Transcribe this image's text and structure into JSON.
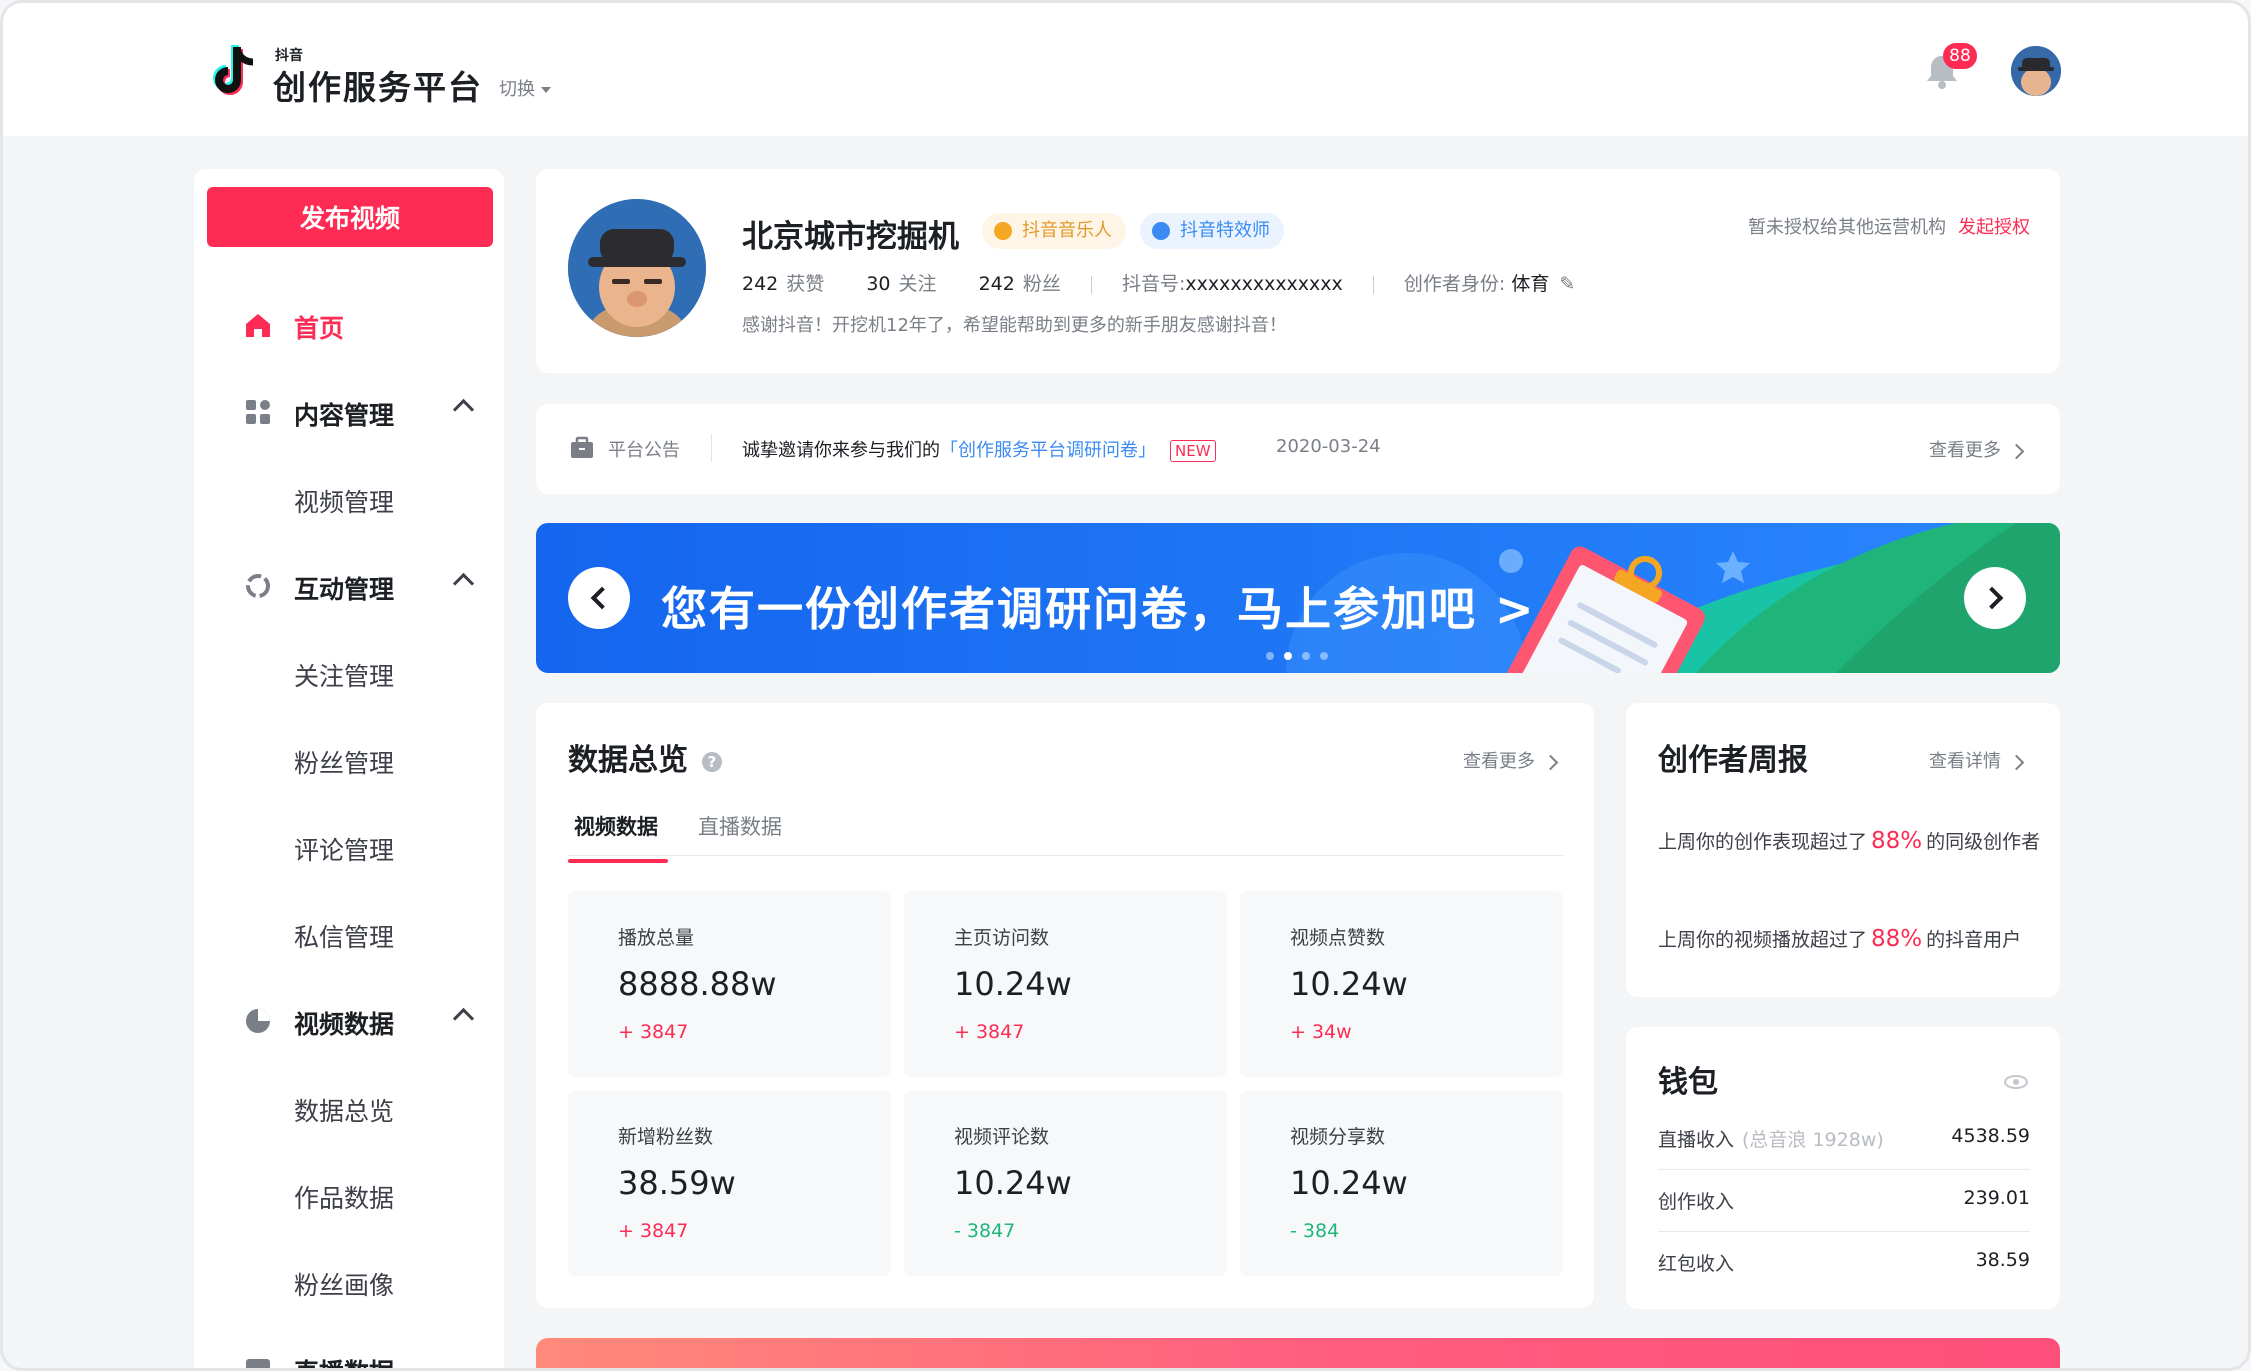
{
  "header": {
    "brand_small": "抖音",
    "brand_title": "创作服务平台",
    "switch_label": "切换",
    "notification_count": "88"
  },
  "sidebar": {
    "publish_label": "发布视频",
    "items": [
      {
        "label": "首页"
      },
      {
        "label": "内容管理"
      },
      {
        "label": "视频管理"
      },
      {
        "label": "互动管理"
      },
      {
        "label": "关注管理"
      },
      {
        "label": "粉丝管理"
      },
      {
        "label": "评论管理"
      },
      {
        "label": "私信管理"
      },
      {
        "label": "视频数据"
      },
      {
        "label": "数据总览"
      },
      {
        "label": "作品数据"
      },
      {
        "label": "粉丝画像"
      },
      {
        "label": "直播数据"
      }
    ]
  },
  "profile": {
    "name": "北京城市挖掘机",
    "tag_musician": "抖音音乐人",
    "tag_effects": "抖音特效师",
    "likes_count": "242",
    "likes_label": "获赞",
    "following_count": "30",
    "following_label": "关注",
    "fans_count": "242",
    "fans_label": "粉丝",
    "douyin_id_label": "抖音号:",
    "douyin_id": "xxxxxxxxxxxxxx",
    "identity_label": "创作者身份:",
    "identity_value": "体育",
    "bio": "感谢抖音！开挖机12年了，希望能帮助到更多的新手朋友感谢抖音！",
    "auth_note": "暂未授权给其他运营机构",
    "auth_link": "发起授权"
  },
  "notice": {
    "label": "平台公告",
    "text_prefix": "诚挚邀请你来参与我们的",
    "link": "「创作服务平台调研问卷」",
    "new_tag": "NEW",
    "date": "2020-03-24",
    "more": "查看更多"
  },
  "banner": {
    "text": "您有一份创作者调研问卷，马上参加吧 >"
  },
  "overview": {
    "title": "数据总览",
    "more": "查看更多",
    "tabs": [
      {
        "label": "视频数据"
      },
      {
        "label": "直播数据"
      }
    ],
    "metrics": [
      {
        "label": "播放总量",
        "value": "8888.88w",
        "delta": "+ 3847"
      },
      {
        "label": "主页访问数",
        "value": "10.24w",
        "delta": "+ 3847"
      },
      {
        "label": "视频点赞数",
        "value": "10.24w",
        "delta": "+ 34w"
      },
      {
        "label": "新增粉丝数",
        "value": "38.59w",
        "delta": "+ 3847"
      },
      {
        "label": "视频评论数",
        "value": "10.24w",
        "delta": "- 3847"
      },
      {
        "label": "视频分享数",
        "value": "10.24w",
        "delta": "- 384"
      }
    ]
  },
  "weekly": {
    "title": "创作者周报",
    "more": "查看详情",
    "line1_prefix": "上周你的创作表现超过了",
    "line1_pct": "88%",
    "line1_suffix": "的同级创作者",
    "line2_prefix": "上周你的视频播放超过了",
    "line2_pct": "88%",
    "line2_suffix": "的抖音用户"
  },
  "wallet": {
    "title": "钱包",
    "rows": [
      {
        "label": "直播收入",
        "sub": "(总音浪 1928w)",
        "value": "4538.59"
      },
      {
        "label": "创作收入",
        "sub": "",
        "value": "239.01"
      },
      {
        "label": "红包收入",
        "sub": "",
        "value": "38.59"
      }
    ]
  },
  "colors": {
    "accent": "#fe2c55",
    "link_blue": "#3b8bf3",
    "positive_green": "#20b77b",
    "banner_blue": "#1565ee"
  }
}
